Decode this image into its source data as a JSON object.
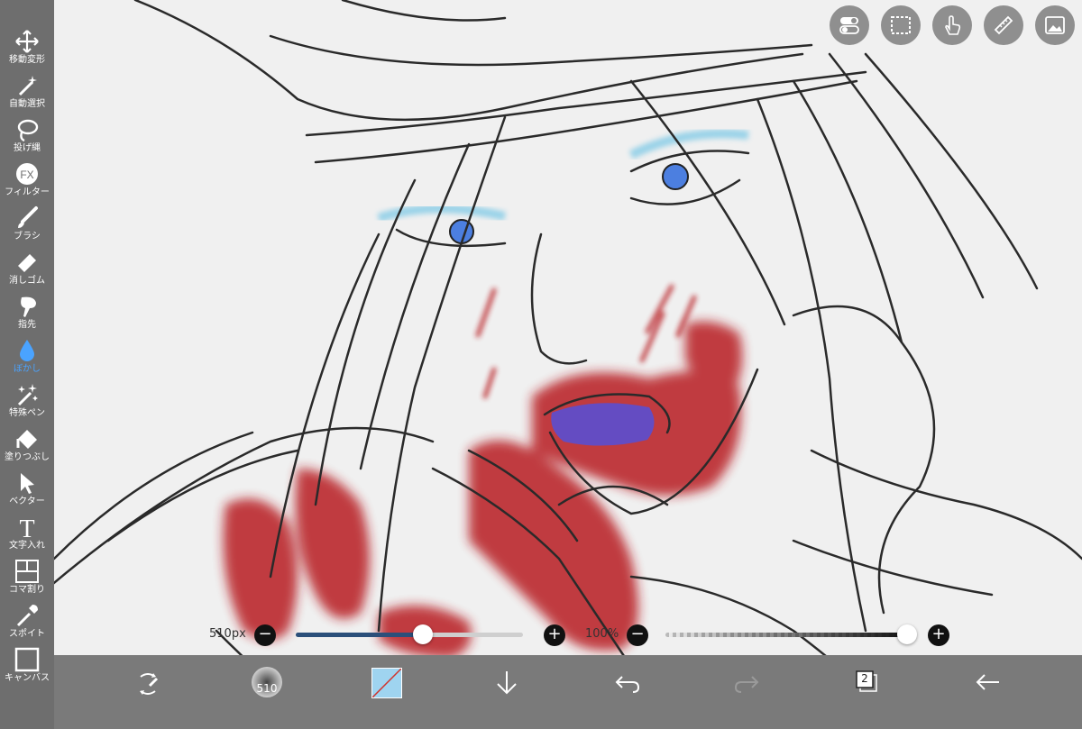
{
  "sidebar": {
    "tools": [
      {
        "id": "move",
        "label": "移動変形",
        "icon": "move-arrows-icon"
      },
      {
        "id": "magic",
        "label": "自動選択",
        "icon": "magic-wand-icon"
      },
      {
        "id": "lasso",
        "label": "投げ縄",
        "icon": "lasso-icon"
      },
      {
        "id": "filter",
        "label": "フィルター",
        "icon": "fx-icon",
        "glyph": "FX"
      },
      {
        "id": "brush",
        "label": "ブラシ",
        "icon": "brush-icon"
      },
      {
        "id": "eraser",
        "label": "消しゴム",
        "icon": "eraser-icon"
      },
      {
        "id": "smudge",
        "label": "指先",
        "icon": "smudge-icon"
      },
      {
        "id": "blur",
        "label": "ぼかし",
        "icon": "blur-drop-icon",
        "active": true
      },
      {
        "id": "special",
        "label": "特殊ペン",
        "icon": "sparkle-pen-icon"
      },
      {
        "id": "fill",
        "label": "塗りつぶし",
        "icon": "paint-bucket-icon"
      },
      {
        "id": "vector",
        "label": "ベクター",
        "icon": "cursor-arrow-icon"
      },
      {
        "id": "text",
        "label": "文字入れ",
        "icon": "text-t-icon",
        "glyph": "T"
      },
      {
        "id": "frame",
        "label": "コマ割り",
        "icon": "panel-divide-icon"
      },
      {
        "id": "eyedropper",
        "label": "スポイト",
        "icon": "eyedropper-icon"
      },
      {
        "id": "canvas",
        "label": "キャンバス",
        "icon": "canvas-square-icon"
      }
    ],
    "active_color": "#4aa3ff"
  },
  "top_right": [
    "toggle-switch-icon",
    "selection-rect-icon",
    "touch-hand-icon",
    "ruler-icon",
    "image-reference-icon"
  ],
  "sliders": {
    "size": {
      "value_label": "510px",
      "fill": 0.56
    },
    "opacity": {
      "value_label": "100%",
      "fill": 1.0
    }
  },
  "bottom_bar": {
    "brush_size_label": "510",
    "layer_count": "2",
    "primary_color": "#9fd4f0",
    "items": [
      "transform-rotate-icon",
      "brush-preview",
      "color-swatch",
      "download-arrow-icon",
      "undo-icon",
      "redo-icon",
      "layers-icon",
      "back-arrow-icon"
    ]
  },
  "colors": {
    "blood": "#b81d24",
    "eye": "#4c7fe0",
    "shadow": "#7ec9e6",
    "line": "#2a2a2a"
  }
}
